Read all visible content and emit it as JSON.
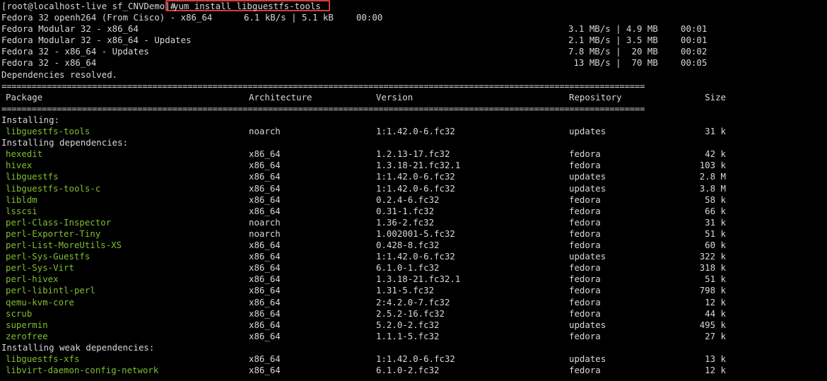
{
  "prompt": "[root@localhost-live sf_CNVDemo]#",
  "command": "yum install libguestfs-tools",
  "colors": {
    "background": "#000000",
    "text": "#d8d8d8",
    "package": "#7fbf2f",
    "highlight": "#e03a3a"
  },
  "repos": [
    {
      "name": "Fedora 32 openh264 (From Cisco) - x86_64",
      "rate": "6.1 kB/s | 5.1 kB",
      "time": "00:00"
    },
    {
      "name": "Fedora Modular 32 - x86_64",
      "rate": "3.1 MB/s | 4.9 MB",
      "time": "00:01"
    },
    {
      "name": "Fedora Modular 32 - x86_64 - Updates",
      "rate": "2.1 MB/s | 3.5 MB",
      "time": "00:01"
    },
    {
      "name": "Fedora 32 - x86_64 - Updates",
      "rate": "7.8 MB/s |  20 MB",
      "time": "00:02"
    },
    {
      "name": "Fedora 32 - x86_64",
      "rate": " 13 MB/s |  70 MB",
      "time": "00:05"
    }
  ],
  "resolved": "Dependencies resolved.",
  "rule": "================================================================================================================================",
  "headers": {
    "package": "Package",
    "arch": "Architecture",
    "version": "Version",
    "repo": "Repository",
    "size": "Size"
  },
  "sections": {
    "installing": "Installing:",
    "deps": "Installing dependencies:",
    "weak": "Installing weak dependencies:"
  },
  "installing": [
    {
      "name": "libguestfs-tools",
      "arch": "noarch",
      "version": "1:1.42.0-6.fc32",
      "repo": "updates",
      "size": "31 k"
    }
  ],
  "deps": [
    {
      "name": "hexedit",
      "arch": "x86_64",
      "version": "1.2.13-17.fc32",
      "repo": "fedora",
      "size": "42 k"
    },
    {
      "name": "hivex",
      "arch": "x86_64",
      "version": "1.3.18-21.fc32.1",
      "repo": "fedora",
      "size": "103 k"
    },
    {
      "name": "libguestfs",
      "arch": "x86_64",
      "version": "1:1.42.0-6.fc32",
      "repo": "updates",
      "size": "2.8 M"
    },
    {
      "name": "libguestfs-tools-c",
      "arch": "x86_64",
      "version": "1:1.42.0-6.fc32",
      "repo": "updates",
      "size": "3.8 M"
    },
    {
      "name": "libldm",
      "arch": "x86_64",
      "version": "0.2.4-6.fc32",
      "repo": "fedora",
      "size": "58 k"
    },
    {
      "name": "lsscsi",
      "arch": "x86_64",
      "version": "0.31-1.fc32",
      "repo": "fedora",
      "size": "66 k"
    },
    {
      "name": "perl-Class-Inspector",
      "arch": "noarch",
      "version": "1.36-2.fc32",
      "repo": "fedora",
      "size": "31 k"
    },
    {
      "name": "perl-Exporter-Tiny",
      "arch": "noarch",
      "version": "1.002001-5.fc32",
      "repo": "fedora",
      "size": "51 k"
    },
    {
      "name": "perl-List-MoreUtils-XS",
      "arch": "x86_64",
      "version": "0.428-8.fc32",
      "repo": "fedora",
      "size": "60 k"
    },
    {
      "name": "perl-Sys-Guestfs",
      "arch": "x86_64",
      "version": "1:1.42.0-6.fc32",
      "repo": "updates",
      "size": "322 k"
    },
    {
      "name": "perl-Sys-Virt",
      "arch": "x86_64",
      "version": "6.1.0-1.fc32",
      "repo": "fedora",
      "size": "318 k"
    },
    {
      "name": "perl-hivex",
      "arch": "x86_64",
      "version": "1.3.18-21.fc32.1",
      "repo": "fedora",
      "size": "51 k"
    },
    {
      "name": "perl-libintl-perl",
      "arch": "x86_64",
      "version": "1.31-5.fc32",
      "repo": "fedora",
      "size": "798 k"
    },
    {
      "name": "qemu-kvm-core",
      "arch": "x86_64",
      "version": "2:4.2.0-7.fc32",
      "repo": "fedora",
      "size": "12 k"
    },
    {
      "name": "scrub",
      "arch": "x86_64",
      "version": "2.5.2-16.fc32",
      "repo": "fedora",
      "size": "44 k"
    },
    {
      "name": "supermin",
      "arch": "x86_64",
      "version": "5.2.0-2.fc32",
      "repo": "updates",
      "size": "495 k"
    },
    {
      "name": "zerofree",
      "arch": "x86_64",
      "version": "1.1.1-5.fc32",
      "repo": "fedora",
      "size": "27 k"
    }
  ],
  "weak": [
    {
      "name": "libguestfs-xfs",
      "arch": "x86_64",
      "version": "1:1.42.0-6.fc32",
      "repo": "updates",
      "size": "13 k"
    },
    {
      "name": "libvirt-daemon-config-network",
      "arch": "x86_64",
      "version": "6.1.0-2.fc32",
      "repo": "fedora",
      "size": "12 k"
    }
  ]
}
